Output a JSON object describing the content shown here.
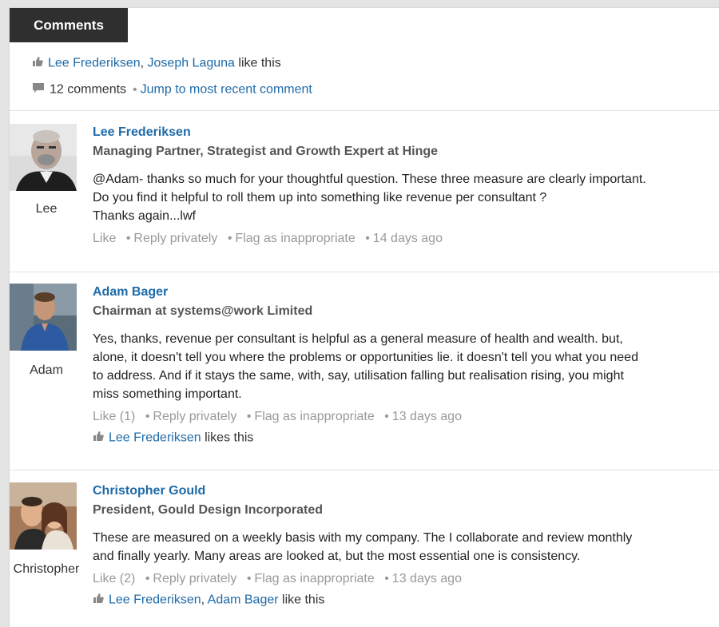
{
  "header": {
    "tab_label": "Comments"
  },
  "likes_summary": {
    "icon": "thumbs-up-icon",
    "names": [
      "Lee Frederiksen",
      "Joseph Laguna"
    ],
    "separator": ", ",
    "suffix": " like this"
  },
  "comments_summary": {
    "icon": "speech-bubble-icon",
    "count_label": "12 comments",
    "jump_label": "Jump to most recent comment"
  },
  "comments": [
    {
      "avatar_caption": "Lee",
      "name": "Lee Frederiksen",
      "title": "Managing Partner, Strategist and Growth Expert at Hinge",
      "text_lines": [
        "@Adam- thanks so much for your thoughtful question. These three measure are clearly important.",
        "Do you find it helpful to roll them up into something like revenue per consultant ?",
        "Thanks again...lwf"
      ],
      "like_label": "Like",
      "reply_label": "Reply privately",
      "flag_label": "Flag as inappropriate",
      "time": "14 days ago"
    },
    {
      "avatar_caption": "Adam",
      "name": "Adam Bager",
      "title": "Chairman at systems@work Limited",
      "text_lines": [
        "Yes, thanks, revenue per consultant is helpful as a general measure of health and wealth. but,",
        "alone, it doesn't tell you where the problems or opportunities lie. it doesn't tell you what you need",
        "to address. And if it stays the same, with, say, utilisation falling but realisation rising, you might",
        "miss something important."
      ],
      "like_label": "Like (1)",
      "reply_label": "Reply privately",
      "flag_label": "Flag as inappropriate",
      "time": "13 days ago",
      "likers": [
        "Lee Frederiksen"
      ],
      "likers_suffix": " likes this"
    },
    {
      "avatar_caption": "Christopher",
      "name": "Christopher Gould",
      "title": "President, Gould Design Incorporated",
      "text_lines": [
        "These are measured on a weekly basis with my company. The I collaborate and review monthly",
        "and finally yearly. Many areas are looked at, but the most essential one is consistency."
      ],
      "like_label": "Like (2)",
      "reply_label": "Reply privately",
      "flag_label": "Flag as inappropriate",
      "time": "13 days ago",
      "likers": [
        "Lee Frederiksen",
        "Adam Bager"
      ],
      "likers_separator": ", ",
      "likers_suffix": " like this"
    }
  ],
  "action_separator": "•",
  "colors": {
    "link": "#1e6aa8",
    "tab_bg": "#2f2f2f",
    "muted": "#999999"
  }
}
